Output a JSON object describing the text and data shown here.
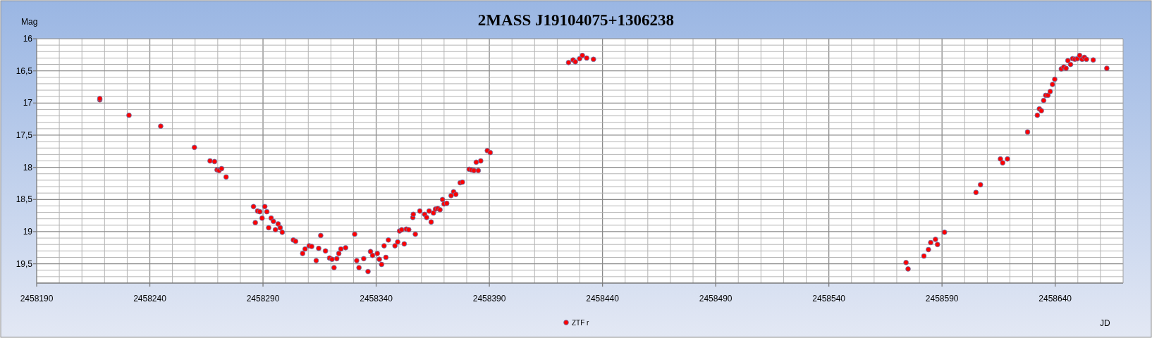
{
  "chart_data": {
    "type": "scatter",
    "title": "2MASS J19104075+1306238",
    "xlabel": "JD",
    "ylabel": "Mag",
    "grid": true,
    "xlim": [
      2458190,
      2458670
    ],
    "ylim": [
      19.8,
      16
    ],
    "xticks": [
      2458190,
      2458240,
      2458290,
      2458340,
      2458390,
      2458440,
      2458490,
      2458540,
      2458590,
      2458640
    ],
    "yticks": [
      {
        "value": 16,
        "label": "16"
      },
      {
        "value": 16.5,
        "label": "16,5"
      },
      {
        "value": 17,
        "label": "17"
      },
      {
        "value": 17.5,
        "label": "17,5"
      },
      {
        "value": 18,
        "label": "18"
      },
      {
        "value": 18.5,
        "label": "18,5"
      },
      {
        "value": 19,
        "label": "19"
      },
      {
        "value": 19.5,
        "label": "19,5"
      }
    ],
    "x": [
      2458217.9,
      2458217.9,
      2458230.8,
      2458244.8,
      2458259.7,
      2458266.6,
      2458268.6,
      2458269.7,
      2458270.6,
      2458271.7,
      2458273.7,
      2458285.8,
      2458286.6,
      2458287.6,
      2458288.6,
      2458289.6,
      2458290.8,
      2458291.7,
      2458292.5,
      2458293.6,
      2458294.6,
      2458295.5,
      2458296.7,
      2458297.6,
      2458298.5,
      2458303.4,
      2458304.4,
      2458307.5,
      2458308.6,
      2458310.4,
      2458311.5,
      2458313.5,
      2458314.6,
      2458315.5,
      2458317.6,
      2458319.4,
      2458320.5,
      2458321.4,
      2458322.6,
      2458323.5,
      2458324.4,
      2458326.5,
      2458330.5,
      2458331.4,
      2458332.4,
      2458334.5,
      2458336.4,
      2458337.5,
      2458338.4,
      2458340.5,
      2458341.4,
      2458342.4,
      2458343.5,
      2458344.3,
      2458345.4,
      2458348.3,
      2458349.5,
      2458350.3,
      2458351.3,
      2458352.4,
      2458353.3,
      2458354.4,
      2458356.2,
      2458356.4,
      2458357.3,
      2458359.3,
      2458361.4,
      2458362.3,
      2458363.4,
      2458364.3,
      2458365.3,
      2458366.2,
      2458367.2,
      2458368.2,
      2458369.3,
      2458370.0,
      2458371.2,
      2458373.1,
      2458374.2,
      2458375.2,
      2458377.1,
      2458378.1,
      2458381.1,
      2458382.1,
      2458383.2,
      2458385.1,
      2458384.2,
      2458386.2,
      2458389.1,
      2458390.4,
      2458425.0,
      2458427.0,
      2458428.0,
      2458429.9,
      2458431.1,
      2458433.0,
      2458436.0,
      2458574.1,
      2458575.0,
      2458582.0,
      2458584.0,
      2458585.0,
      2458587.1,
      2458588.0,
      2458591.1,
      2458605.0,
      2458607.0,
      2458615.8,
      2458616.8,
      2458618.9,
      2458627.8,
      2458632.1,
      2458633.0,
      2458633.9,
      2458634.9,
      2458635.8,
      2458636.8,
      2458637.8,
      2458638.8,
      2458639.8,
      2458642.7,
      2458643.8,
      2458644.8,
      2458645.6,
      2458646.8,
      2458647.7,
      2458648.7,
      2458649.8,
      2458650.8,
      2458651.9,
      2458652.9,
      2458653.8,
      2458656.8,
      2458662.8
    ],
    "series": [
      {
        "name": "ZTF r",
        "color": "#ff0000",
        "values": [
          16.95,
          16.93,
          17.19,
          17.36,
          17.69,
          17.9,
          17.91,
          18.04,
          18.05,
          18.02,
          18.15,
          18.61,
          18.86,
          18.68,
          18.69,
          18.79,
          18.61,
          18.69,
          18.94,
          18.79,
          18.84,
          18.97,
          18.88,
          18.94,
          19.01,
          19.13,
          19.15,
          19.34,
          19.27,
          19.22,
          19.23,
          19.45,
          19.26,
          19.06,
          19.3,
          19.41,
          19.43,
          19.56,
          19.42,
          19.34,
          19.27,
          19.25,
          19.04,
          19.45,
          19.56,
          19.42,
          19.62,
          19.31,
          19.37,
          19.34,
          19.43,
          19.51,
          19.22,
          19.4,
          19.13,
          19.22,
          19.16,
          18.99,
          18.97,
          19.19,
          18.96,
          18.97,
          18.78,
          18.73,
          19.04,
          18.68,
          18.73,
          18.78,
          18.68,
          18.85,
          18.71,
          18.65,
          18.64,
          18.66,
          18.5,
          18.57,
          18.56,
          18.44,
          18.38,
          18.42,
          18.24,
          18.23,
          18.03,
          18.04,
          18.05,
          18.05,
          17.92,
          17.9,
          17.74,
          17.77,
          16.37,
          16.33,
          16.36,
          16.31,
          16.26,
          16.3,
          16.32,
          19.48,
          19.58,
          19.38,
          19.28,
          19.17,
          19.12,
          19.2,
          19.01,
          18.39,
          18.27,
          17.87,
          17.93,
          17.87,
          17.45,
          17.19,
          17.09,
          17.12,
          16.96,
          16.88,
          16.88,
          16.82,
          16.71,
          16.63,
          16.47,
          16.44,
          16.46,
          16.34,
          16.4,
          16.31,
          16.32,
          16.31,
          16.26,
          16.32,
          16.29,
          16.32,
          16.33,
          16.46
        ]
      }
    ]
  }
}
